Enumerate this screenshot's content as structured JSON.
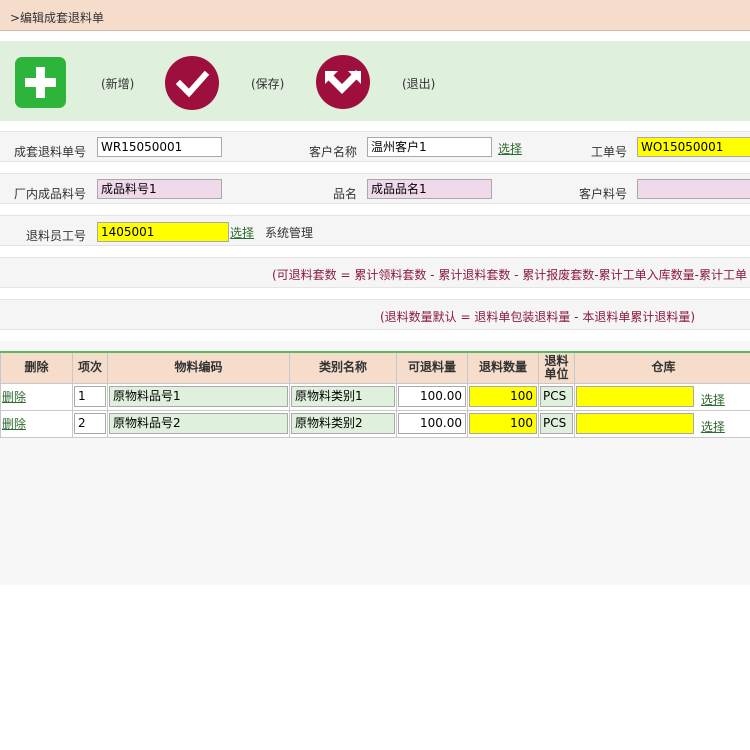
{
  "page": {
    "title": ">编辑成套退料单"
  },
  "toolbar": {
    "add_label": "(新增)",
    "save_label": "(保存)",
    "exit_label": "(退出)"
  },
  "form": {
    "return_no_label": "成套退料单号",
    "return_no_value": "WR15050001",
    "customer_name_label": "客户名称",
    "customer_name_value": "温州客户1",
    "customer_select": "选择",
    "work_order_label": "工单号",
    "work_order_value": "WO15050001",
    "factory_product_label": "厂内成品料号",
    "factory_product_value": "成品料号1",
    "product_name_label": "品名",
    "product_name_value": "成品品名1",
    "customer_part_label": "客户料号",
    "customer_part_value": "",
    "employee_label": "退料员工号",
    "employee_value": "1405001",
    "employee_select": "选择",
    "employee_name": "系统管理",
    "note_sets": "(可退料套数 = 累计领料套数 - 累计退料套数 - 累计报废套数-累计工单入库数量-累计工单",
    "note_qty": "(退料数量默认 = 退料单包装退料量 - 本退料单累计退料量)"
  },
  "table": {
    "headers": {
      "delete": "删除",
      "seq": "项次",
      "material_code": "物料编码",
      "category": "类别名称",
      "returnable": "可退料量",
      "return_qty": "退料数量",
      "unit_line1": "退料",
      "unit_line2": "单位",
      "warehouse": "仓库"
    },
    "rows": [
      {
        "delete": "删除",
        "seq": "1",
        "material_code": "原物料品号1",
        "category": "原物料类别1",
        "returnable": "100.00",
        "return_qty": "100",
        "unit": "PCS",
        "warehouse": "",
        "select": "选择"
      },
      {
        "delete": "删除",
        "seq": "2",
        "material_code": "原物料品号2",
        "category": "原物料类别2",
        "returnable": "100.00",
        "return_qty": "100",
        "unit": "PCS",
        "warehouse": "",
        "select": "选择"
      }
    ]
  },
  "colors": {
    "title_bg": "#f5dccb",
    "toolbar_bg": "#dff0dc",
    "add_button": "#2db43b",
    "action_button": "#9e0f3d",
    "note_text": "#8b1a3a",
    "required_field": "#ffff00",
    "readonly_field": "#f0d9eb"
  },
  "icons": {
    "add": "plus-icon",
    "save": "checkmark-icon",
    "exit": "exit-arrow-icon"
  }
}
